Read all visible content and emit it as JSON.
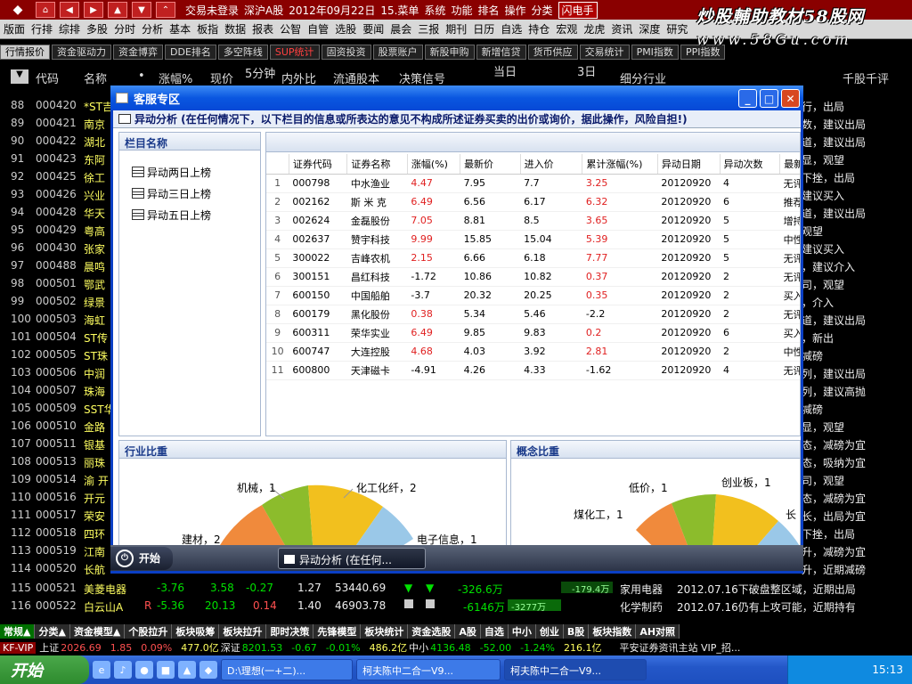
{
  "titlebar": {
    "nav_buttons": [
      "home-icon",
      "back-icon",
      "forward-icon",
      "up-icon",
      "down-icon",
      "collapse-icon"
    ],
    "items": [
      "交易未登录",
      "深沪A股",
      "2012年09月22日",
      "15.菜单",
      "系统",
      "功能",
      "排名",
      "操作",
      "分类"
    ],
    "flash": "闪电手"
  },
  "watermark": {
    "line1": "炒股輔助教材58股网",
    "line2": "www.58Gu.com"
  },
  "menubar": [
    "版面",
    "行排",
    "综排",
    "多股",
    "分时",
    "分析",
    "基本",
    "板指",
    "数据",
    "报表",
    "公智",
    "自管",
    "选股",
    "要闻",
    "晨会",
    "三报",
    "期刊",
    "日历",
    "自选",
    "持仓",
    "宏观",
    "龙虎",
    "资讯",
    "深度",
    "研究"
  ],
  "tabs": [
    {
      "label": "行情报价",
      "style": "active"
    },
    {
      "label": "资金驱动力",
      "style": ""
    },
    {
      "label": "资金博弈",
      "style": ""
    },
    {
      "label": "DDE排名",
      "style": ""
    },
    {
      "label": "多空阵线",
      "style": ""
    },
    {
      "label": "SUP统计",
      "style": "red"
    },
    {
      "label": "固资投资",
      "style": ""
    },
    {
      "label": "股票账户",
      "style": ""
    },
    {
      "label": "新股申购",
      "style": ""
    },
    {
      "label": "新增信贷",
      "style": ""
    },
    {
      "label": "货币供应",
      "style": ""
    },
    {
      "label": "交易统计",
      "style": ""
    },
    {
      "label": "PMI指数",
      "style": ""
    },
    {
      "label": "PPI指数",
      "style": ""
    }
  ],
  "columns": {
    "dropdown": "▼",
    "code": "代码",
    "name": "名称",
    "dot": "•",
    "change": "涨幅%",
    "price": "现价",
    "min5": "5分钟",
    "ratio": "内外比",
    "float": "流通股本",
    "signal": "决策信号",
    "today": "当日",
    "day3": "3日",
    "industry": "细分行业",
    "comment": "千股千评"
  },
  "rows": [
    {
      "num": "88",
      "code": "000420",
      "name": "*ST吉",
      "right": "行，出局"
    },
    {
      "num": "89",
      "code": "000421",
      "name": "南京",
      "right": "数，建议出局"
    },
    {
      "num": "90",
      "code": "000422",
      "name": "湖北",
      "right": "道，建议出局"
    },
    {
      "num": "91",
      "code": "000423",
      "name": "东阿",
      "right": "显，观望"
    },
    {
      "num": "92",
      "code": "000425",
      "name": "徐工",
      "right": "下挫，出局"
    },
    {
      "num": "93",
      "code": "000426",
      "name": "兴业",
      "right": "建议买入"
    },
    {
      "num": "94",
      "code": "000428",
      "name": "华天",
      "right": "道，建议出局"
    },
    {
      "num": "95",
      "code": "000429",
      "name": "粤高",
      "right": "观望"
    },
    {
      "num": "96",
      "code": "000430",
      "name": "张家",
      "right": "建议买入"
    },
    {
      "num": "97",
      "code": "000488",
      "name": "晨鸣",
      "right": "，建议介入"
    },
    {
      "num": "98",
      "code": "000501",
      "name": "鄂武",
      "right": "司，观望"
    },
    {
      "num": "99",
      "code": "000502",
      "name": "绿景",
      "right": "，介入"
    },
    {
      "num": "100",
      "code": "000503",
      "name": "海虹",
      "right": "道，建议出局"
    },
    {
      "num": "101",
      "code": "000504",
      "name": "ST传",
      "right": "，新出"
    },
    {
      "num": "102",
      "code": "000505",
      "name": "ST珠",
      "right": "减磅"
    },
    {
      "num": "103",
      "code": "000506",
      "name": "中润",
      "right": "列，建议出局"
    },
    {
      "num": "104",
      "code": "000507",
      "name": "珠海",
      "right": "列，建议高抛"
    },
    {
      "num": "105",
      "code": "000509",
      "name": "SST华",
      "right": "减磅"
    },
    {
      "num": "106",
      "code": "000510",
      "name": "金路",
      "right": "显，观望"
    },
    {
      "num": "107",
      "code": "000511",
      "name": "银基",
      "right": "态，减磅为宜"
    },
    {
      "num": "108",
      "code": "000513",
      "name": "丽珠",
      "right": "态，吸纳为宜"
    },
    {
      "num": "109",
      "code": "000514",
      "name": "渝 开",
      "right": "司，观望"
    },
    {
      "num": "110",
      "code": "000516",
      "name": "开元",
      "right": "态，减磅为宜"
    },
    {
      "num": "111",
      "code": "000517",
      "name": "荣安",
      "right": "长，出局为宜"
    },
    {
      "num": "112",
      "code": "000518",
      "name": "四环",
      "right": "下挫，出局"
    },
    {
      "num": "113",
      "code": "000519",
      "name": "江南",
      "right": "升，减磅为宜"
    },
    {
      "num": "114",
      "code": "000520",
      "name": "长航",
      "right": "升，近期减磅"
    }
  ],
  "full_rows": [
    {
      "num": "115",
      "code": "000521",
      "name": "美菱电器",
      "flag": "",
      "chg": "-3.76",
      "price": "3.58",
      "m5": "-0.27",
      "ratio": "1.27",
      "float": "53440.69",
      "today": "-326.6万",
      "day3": "-179.4万",
      "industry": "家用电器",
      "comment": "2012.07.16下破盘整区域，近期出局"
    },
    {
      "num": "116",
      "code": "000522",
      "name": "白云山A",
      "flag": "R",
      "chg": "-5.36",
      "price": "20.13",
      "m5": "0.14",
      "ratio": "1.40",
      "float": "46903.78",
      "today": "-6146万",
      "day3": "-3277万",
      "industry": "化学制药",
      "comment": "2012.07.16仍有上攻可能，近期持有"
    }
  ],
  "bottombar": [
    "常规▲",
    "分类▲",
    "资金模型▲",
    "个股拉升",
    "板块吸筹",
    "板块拉升",
    "即时决策",
    "先锋模型",
    "板块统计",
    "资金选股",
    "A股",
    "自选",
    "中小",
    "创业",
    "B股",
    "板块指数",
    "AH对照"
  ],
  "indexbar": {
    "kf": "KF-VIP",
    "sh_label": "上证",
    "sh_value": "2026.69",
    "sh_chg": "1.85",
    "sh_pct": "0.09%",
    "sh_amt": "477.0亿",
    "sz_label": "深证",
    "sz_value": "8201.53",
    "sz_chg": "-0.67",
    "sz_pct": "-0.01%",
    "sz_amt": "486.2亿",
    "zx_label": "中小",
    "zx_value": "4136.48",
    "zx_chg": "-52.00",
    "zx_pct": "-1.24%",
    "zx_amt": "216.1亿",
    "news": "平安证券资讯主站 VIP_招..."
  },
  "taskbar": {
    "start": "开始",
    "tasks": [
      "D:\\理想(一+二)...",
      "柯夫陈中二合一V9...",
      "柯夫陈中二合一V9..."
    ],
    "clock": "15:13"
  },
  "dialog": {
    "title": "客服专区",
    "notice": "异动分析 (在任何情况下，以下栏目的信息或所表达的意见不构成所述证券买卖的出价或询价，据此操作，风险自担!)",
    "left_header": "栏目名称",
    "left_items": [
      "异动两日上榜",
      "异动三日上榜",
      "异动五日上榜"
    ],
    "table_headers": [
      "",
      "证券代码",
      "证券名称",
      "涨幅(%)",
      "最新价",
      "进入价",
      "累计涨幅(%)",
      "异动日期",
      "异动次数",
      "最新评级"
    ],
    "table_rows": [
      [
        "1",
        "000798",
        "中水渔业",
        "4.47",
        "7.95",
        "7.7",
        "3.25",
        "20120920",
        "4",
        "无评级"
      ],
      [
        "2",
        "002162",
        "斯 米 克",
        "6.49",
        "6.56",
        "6.17",
        "6.32",
        "20120920",
        "6",
        "推荐"
      ],
      [
        "3",
        "002624",
        "金磊股份",
        "7.05",
        "8.81",
        "8.5",
        "3.65",
        "20120920",
        "5",
        "增持"
      ],
      [
        "4",
        "002637",
        "赞宇科技",
        "9.99",
        "15.85",
        "15.04",
        "5.39",
        "20120920",
        "5",
        "中性"
      ],
      [
        "5",
        "300022",
        "吉峰农机",
        "2.15",
        "6.66",
        "6.18",
        "7.77",
        "20120920",
        "5",
        "无评级"
      ],
      [
        "6",
        "300151",
        "昌红科技",
        "-1.72",
        "10.86",
        "10.82",
        "0.37",
        "20120920",
        "2",
        "无评级"
      ],
      [
        "7",
        "600150",
        "中国船舶",
        "-3.7",
        "20.32",
        "20.25",
        "0.35",
        "20120920",
        "2",
        "买入"
      ],
      [
        "8",
        "600179",
        "黑化股份",
        "0.38",
        "5.34",
        "5.46",
        "-2.2",
        "20120920",
        "2",
        "无评级"
      ],
      [
        "9",
        "600311",
        "荣华实业",
        "6.49",
        "9.85",
        "9.83",
        "0.2",
        "20120920",
        "6",
        "买入"
      ],
      [
        "10",
        "600747",
        "大连控股",
        "4.68",
        "4.03",
        "3.92",
        "2.81",
        "20120920",
        "2",
        "中性"
      ],
      [
        "11",
        "600800",
        "天津磁卡",
        "-4.91",
        "4.26",
        "4.33",
        "-1.62",
        "20120920",
        "4",
        "无评级"
      ]
    ],
    "industry_title": "行业比重",
    "industry_labels": [
      "机械，1",
      "化工化纤，2",
      "建材，2",
      "电子信息，1"
    ],
    "concept_title": "概念比重",
    "concept_labels": [
      "低价，1",
      "创业板，1",
      "煤化工，1",
      "长"
    ],
    "bar_start": "开始",
    "bar_task": "异动分析 (在任何..."
  }
}
